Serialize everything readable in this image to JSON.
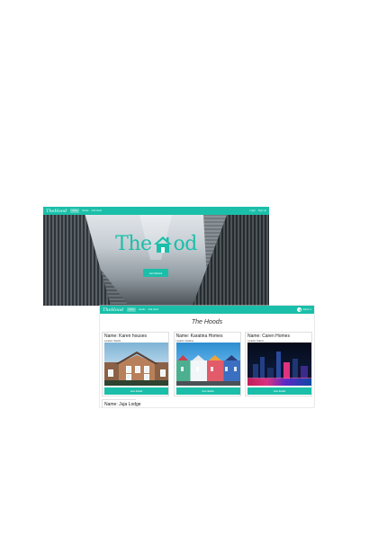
{
  "landing": {
    "nav": {
      "logo": "TheHood",
      "links": [
        "Home",
        "Hoods",
        "Add Hood"
      ],
      "auth": [
        "Login",
        "Sign Up"
      ]
    },
    "brand": {
      "left": "The",
      "right": "od"
    },
    "cta_label": "Get Started"
  },
  "listing": {
    "nav": {
      "logo": "TheHood",
      "links": [
        "Home",
        "Hoods",
        "Add Hood"
      ],
      "user": "Admin"
    },
    "title": "The Hoods",
    "cards": [
      {
        "name": "Name: Karen houses",
        "location": "Location: Nairobi",
        "button": "view details"
      },
      {
        "name": "Name: Karatina Homes",
        "location": "Location: Karatina",
        "button": "view details"
      },
      {
        "name": "Name: Caren Homes",
        "location": "Location: Nakuru",
        "button": "view details"
      }
    ],
    "next_card_name": "Name: Juja Lodge"
  },
  "colors": {
    "accent": "#1bbfa9"
  }
}
